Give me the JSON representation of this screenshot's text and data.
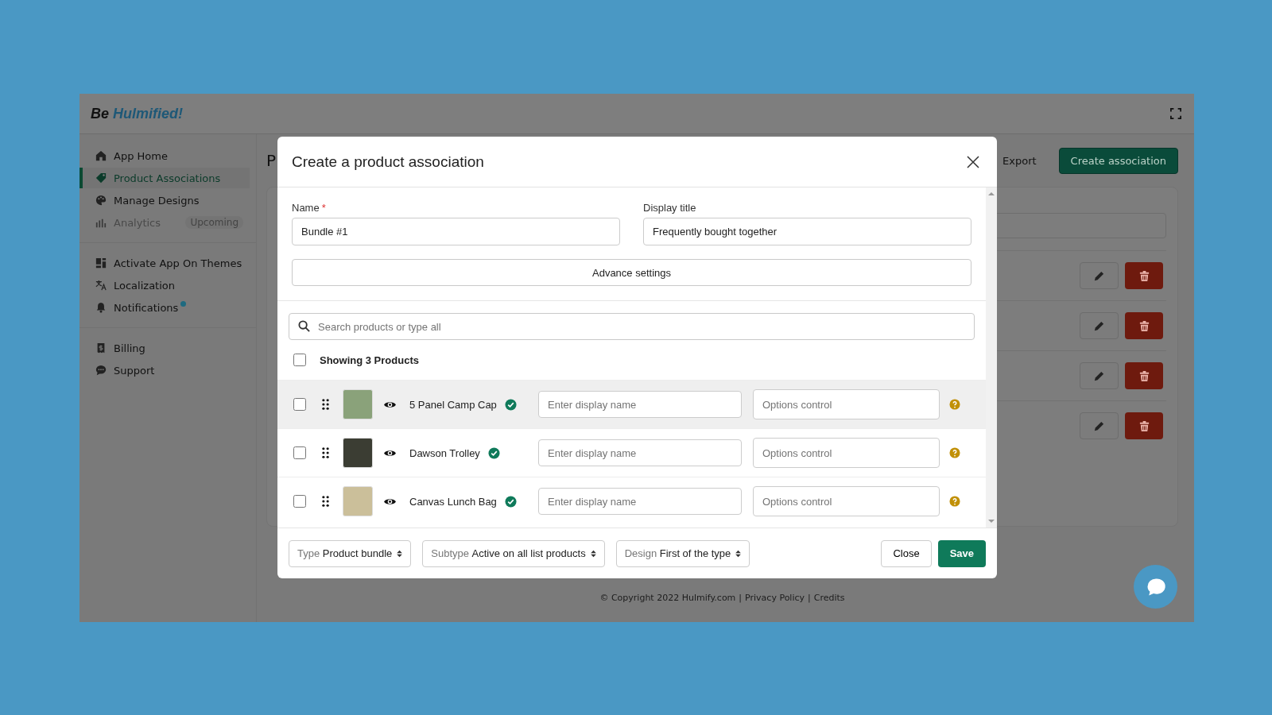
{
  "app": {
    "logo_prefix": "Be",
    "logo_brand": "Hulmified!"
  },
  "sidebar": {
    "sections": [
      {
        "items": [
          {
            "label": "App Home",
            "selected": false,
            "disabled": false
          },
          {
            "label": "Product Associations",
            "selected": true,
            "disabled": false
          },
          {
            "label": "Manage Designs",
            "selected": false,
            "disabled": false
          },
          {
            "label": "Analytics",
            "selected": false,
            "disabled": true,
            "badge": "Upcoming"
          }
        ]
      },
      {
        "items": [
          {
            "label": "Activate App On Themes",
            "selected": false,
            "disabled": false
          },
          {
            "label": "Localization",
            "selected": false,
            "disabled": false
          },
          {
            "label": "Notifications",
            "selected": false,
            "disabled": false,
            "dot": true
          }
        ]
      },
      {
        "items": [
          {
            "label": "Billing",
            "selected": false,
            "disabled": false
          },
          {
            "label": "Support",
            "selected": false,
            "disabled": false
          }
        ]
      }
    ]
  },
  "main": {
    "page_title": "P",
    "export": "Export",
    "create_button": "Create association"
  },
  "footer": {
    "copyright": "© Copyright 2022 Hulmify.com",
    "separator": "|",
    "links": [
      "Privacy Policy",
      "Credits"
    ]
  },
  "modal": {
    "title": "Create a product association",
    "name": {
      "label": "Name",
      "required_mark": "*",
      "value": "Bundle #1"
    },
    "display_title": {
      "label": "Display title",
      "value": "Frequently bought together"
    },
    "advance_button": "Advance settings",
    "search": {
      "placeholder": "Search products or type all"
    },
    "select_all": {
      "label": "Showing 3 Products",
      "checked": false
    },
    "products": [
      {
        "name": "5 Panel Camp Cap",
        "checked": false,
        "highlighted": true,
        "display_placeholder": "Enter display name",
        "options_placeholder": "Options control"
      },
      {
        "name": "Dawson Trolley",
        "checked": false,
        "highlighted": false,
        "display_placeholder": "Enter display name",
        "options_placeholder": "Options control"
      },
      {
        "name": "Canvas Lunch Bag",
        "checked": false,
        "highlighted": false,
        "display_placeholder": "Enter display name",
        "options_placeholder": "Options control"
      }
    ],
    "selects": [
      {
        "label": "Type",
        "value": "Product bundle"
      },
      {
        "label": "Subtype",
        "value": "Active on all list products"
      },
      {
        "label": "Design",
        "value": "First of the type"
      }
    ],
    "buttons": {
      "close": "Close",
      "save": "Save"
    }
  }
}
